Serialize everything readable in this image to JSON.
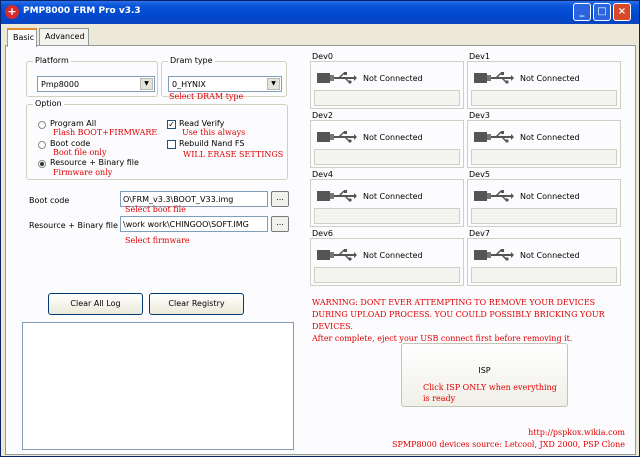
{
  "window": {
    "title": "PMP8000 FRM Pro v3.3",
    "title_icon": "+",
    "minimize": "_",
    "maximize": "□",
    "close": "×"
  },
  "tabs": [
    {
      "label": "Basic",
      "active": true
    },
    {
      "label": "Advanced",
      "active": false
    }
  ],
  "platform": {
    "label": "Platform",
    "value": "Pmp8000"
  },
  "dram": {
    "label": "Dram type",
    "value": "0_HYNIX",
    "hint": "Select DRAM type"
  },
  "option": {
    "label": "Option",
    "radios": [
      {
        "label": "Program All",
        "hint": "Flash BOOT+FIRMWARE",
        "selected": false
      },
      {
        "label": "Boot code",
        "hint": "Boot file only",
        "selected": false
      },
      {
        "label": "Resource + Binary file",
        "hint": "Firmware only",
        "selected": true
      }
    ],
    "checks": [
      {
        "label": "Read Verify",
        "hint": "Use this always",
        "checked": true,
        "mark": "✓"
      },
      {
        "label": "Rebuild Nand FS",
        "hint": "WILL ERASE SETTINGS",
        "checked": false,
        "mark": ""
      }
    ]
  },
  "boot_code": {
    "label": "Boot code",
    "value": "O\\FRM_v3.3\\BOOT_V33.img",
    "hint": "Select boot file",
    "browse": "..."
  },
  "resource": {
    "label": "Resource + Binary file",
    "value": "\\work work\\CHINGOO\\SOFT.IMG",
    "hint": "Select firmware",
    "browse": "..."
  },
  "buttons": {
    "clear_log": "Clear All Log",
    "clear_registry": "Clear Registry",
    "isp": "ISP"
  },
  "devices": [
    {
      "name": "Dev0",
      "status": "Not Connected"
    },
    {
      "name": "Dev1",
      "status": "Not Connected"
    },
    {
      "name": "Dev2",
      "status": "Not Connected"
    },
    {
      "name": "Dev3",
      "status": "Not Connected"
    },
    {
      "name": "Dev4",
      "status": "Not Connected"
    },
    {
      "name": "Dev5",
      "status": "Not Connected"
    },
    {
      "name": "Dev6",
      "status": "Not Connected"
    },
    {
      "name": "Dev7",
      "status": "Not Connected"
    }
  ],
  "warning": {
    "line1": "WARNING: DONT EVER ATTEMPTING TO REMOVE YOUR DEVICES",
    "line2": "DURING UPLOAD PROCESS. YOU COULD POSSIBLY BRICKING YOUR",
    "line3": "DEVICES.",
    "line4": "After complete, eject your USB  connect first before removing it."
  },
  "isp_hint": {
    "line1": "Click ISP ONLY when everything",
    "line2": "is ready"
  },
  "credits": {
    "url": "http://pspkox.wikia.com",
    "source": "SPMP8000 devices source: Letcool, JXD  2000, PSP Clone"
  },
  "colors": {
    "hint_red": "#e00000",
    "titlebar_blue": "#0a56d8"
  },
  "icons": {
    "device": "usb-icon"
  }
}
